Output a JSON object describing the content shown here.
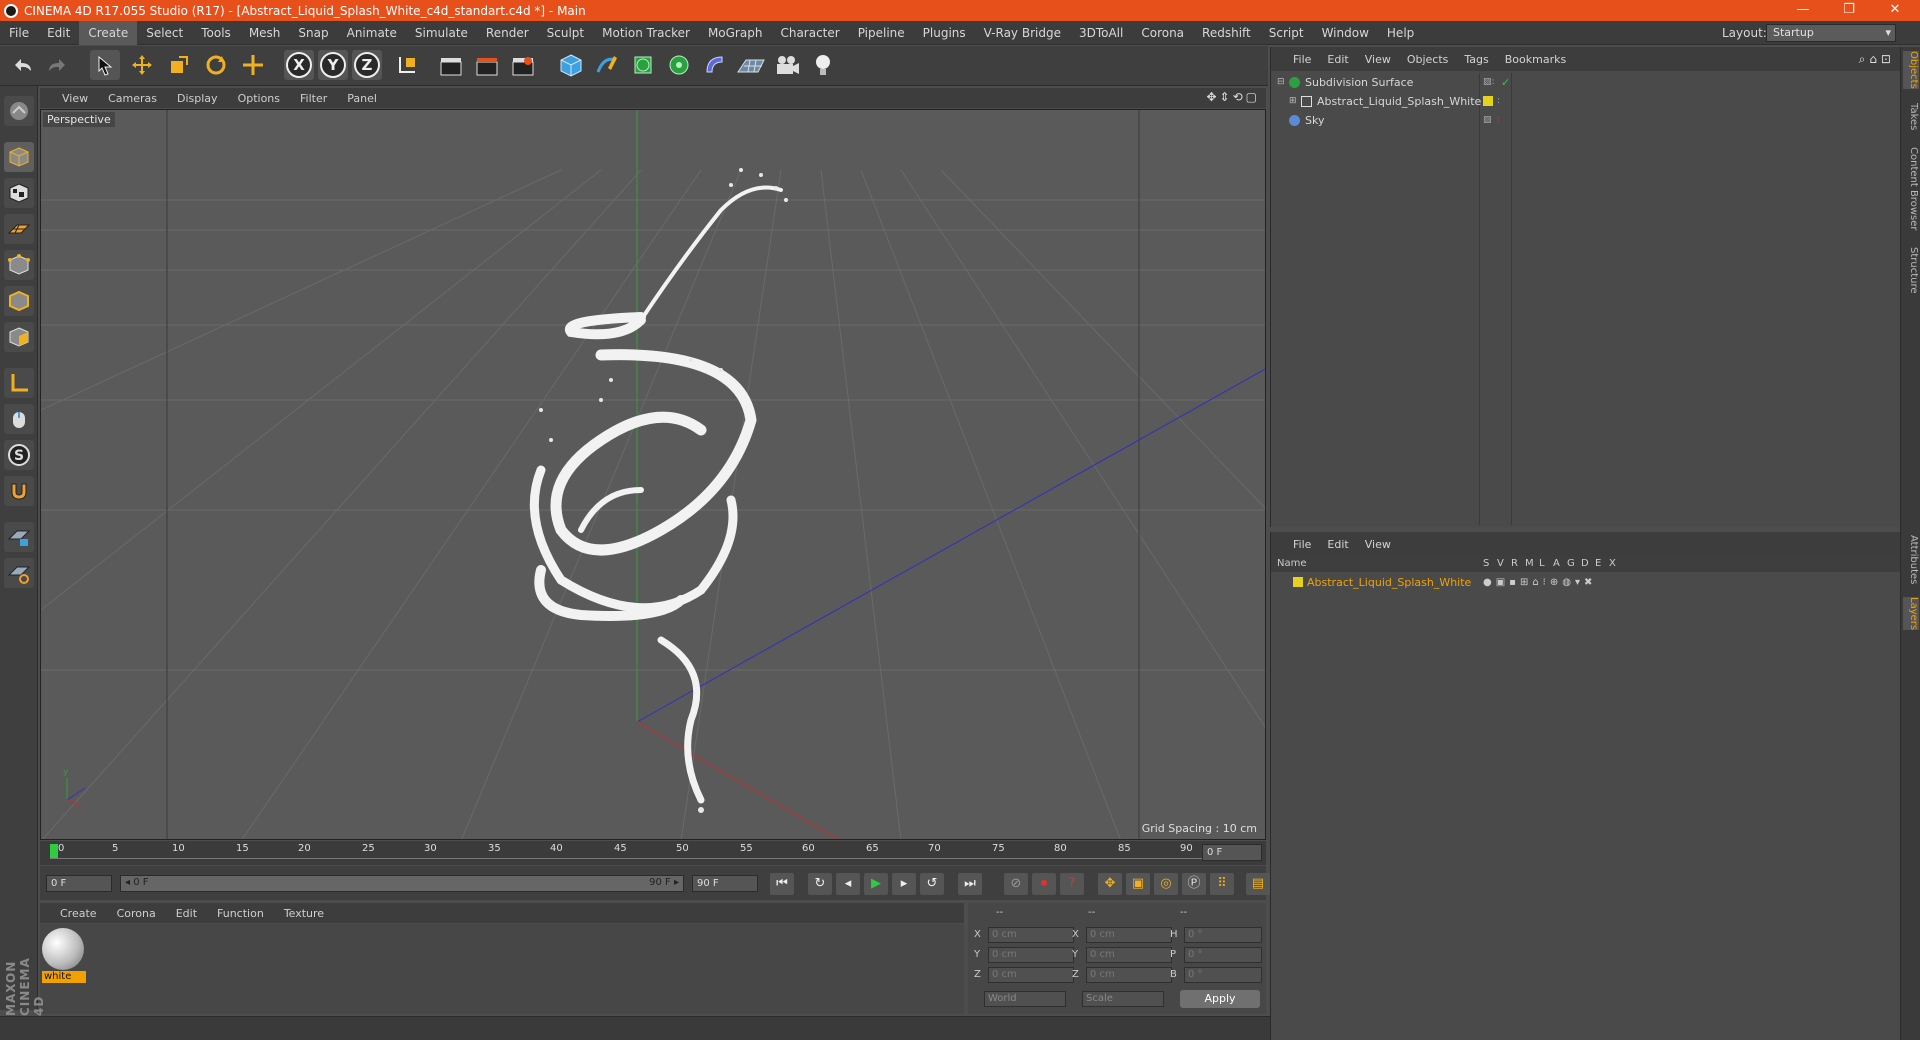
{
  "window": {
    "title": "CINEMA 4D R17.055 Studio (R17) - [Abstract_Liquid_Splash_White_c4d_standart.c4d *] - Main",
    "minimize": "—",
    "restore": "❐",
    "close": "✕"
  },
  "menubar": {
    "items": [
      "File",
      "Edit",
      "Create",
      "Select",
      "Tools",
      "Mesh",
      "Snap",
      "Animate",
      "Simulate",
      "Render",
      "Sculpt",
      "Motion Tracker",
      "MoGraph",
      "Character",
      "Pipeline",
      "Plugins",
      "V-Ray Bridge",
      "3DToAll",
      "Corona",
      "Redshift",
      "Script",
      "Window",
      "Help"
    ],
    "active": "Create",
    "layout_label": "Layout:",
    "layout_value": "Startup"
  },
  "toolbar": {
    "axis_x": "X",
    "axis_y": "Y",
    "axis_z": "Z"
  },
  "viewport": {
    "menu": [
      "View",
      "Cameras",
      "Display",
      "Options",
      "Filter",
      "Panel"
    ],
    "label": "Perspective",
    "grid_spacing": "Grid Spacing : 10 cm"
  },
  "timeline": {
    "ticks": [
      "0",
      "5",
      "10",
      "15",
      "20",
      "25",
      "30",
      "35",
      "40",
      "45",
      "50",
      "55",
      "60",
      "65",
      "70",
      "75",
      "80",
      "85",
      "90"
    ],
    "frame_field": "0 F"
  },
  "timecontrol": {
    "start": "0 F",
    "range_start": "◂ 0 F",
    "range_end": "90 F ▸",
    "end": "90 F"
  },
  "material_panel": {
    "menu": [
      "Create",
      "Corona",
      "Edit",
      "Function",
      "Texture"
    ],
    "materials": [
      {
        "name": "white"
      }
    ]
  },
  "coords": {
    "headers": [
      "--",
      "--",
      "--"
    ],
    "rows": [
      {
        "a": "X",
        "av": "0 cm",
        "b": "X",
        "bv": "0 cm",
        "c": "H",
        "cv": "0 °"
      },
      {
        "a": "Y",
        "av": "0 cm",
        "b": "Y",
        "bv": "0 cm",
        "c": "P",
        "cv": "0 °"
      },
      {
        "a": "Z",
        "av": "0 cm",
        "b": "Z",
        "bv": "0 cm",
        "c": "B",
        "cv": "0 °"
      }
    ],
    "world": "World",
    "scale": "Scale",
    "apply": "Apply"
  },
  "branding": {
    "text": "MAXON CINEMA 4D"
  },
  "object_panel": {
    "menu": [
      "File",
      "Edit",
      "View",
      "Objects",
      "Tags",
      "Bookmarks"
    ],
    "objects": [
      {
        "name": "Subdivision Surface"
      },
      {
        "name": "Abstract_Liquid_Splash_White"
      },
      {
        "name": "Sky"
      }
    ]
  },
  "layer_panel": {
    "menu": [
      "File",
      "Edit",
      "View"
    ],
    "columns": [
      "Name",
      "S",
      "V",
      "R",
      "M",
      "L",
      "A",
      "G",
      "D",
      "E",
      "X"
    ],
    "layers": [
      {
        "name": "Abstract_Liquid_Splash_White",
        "color": "#e6d21e"
      }
    ]
  },
  "side_tabs": [
    "Objects",
    "Takes",
    "Content Browser",
    "Structure",
    "Attributes",
    "Layers"
  ],
  "colors": {
    "accent": "#e8501b",
    "highlight": "#f2a200"
  }
}
